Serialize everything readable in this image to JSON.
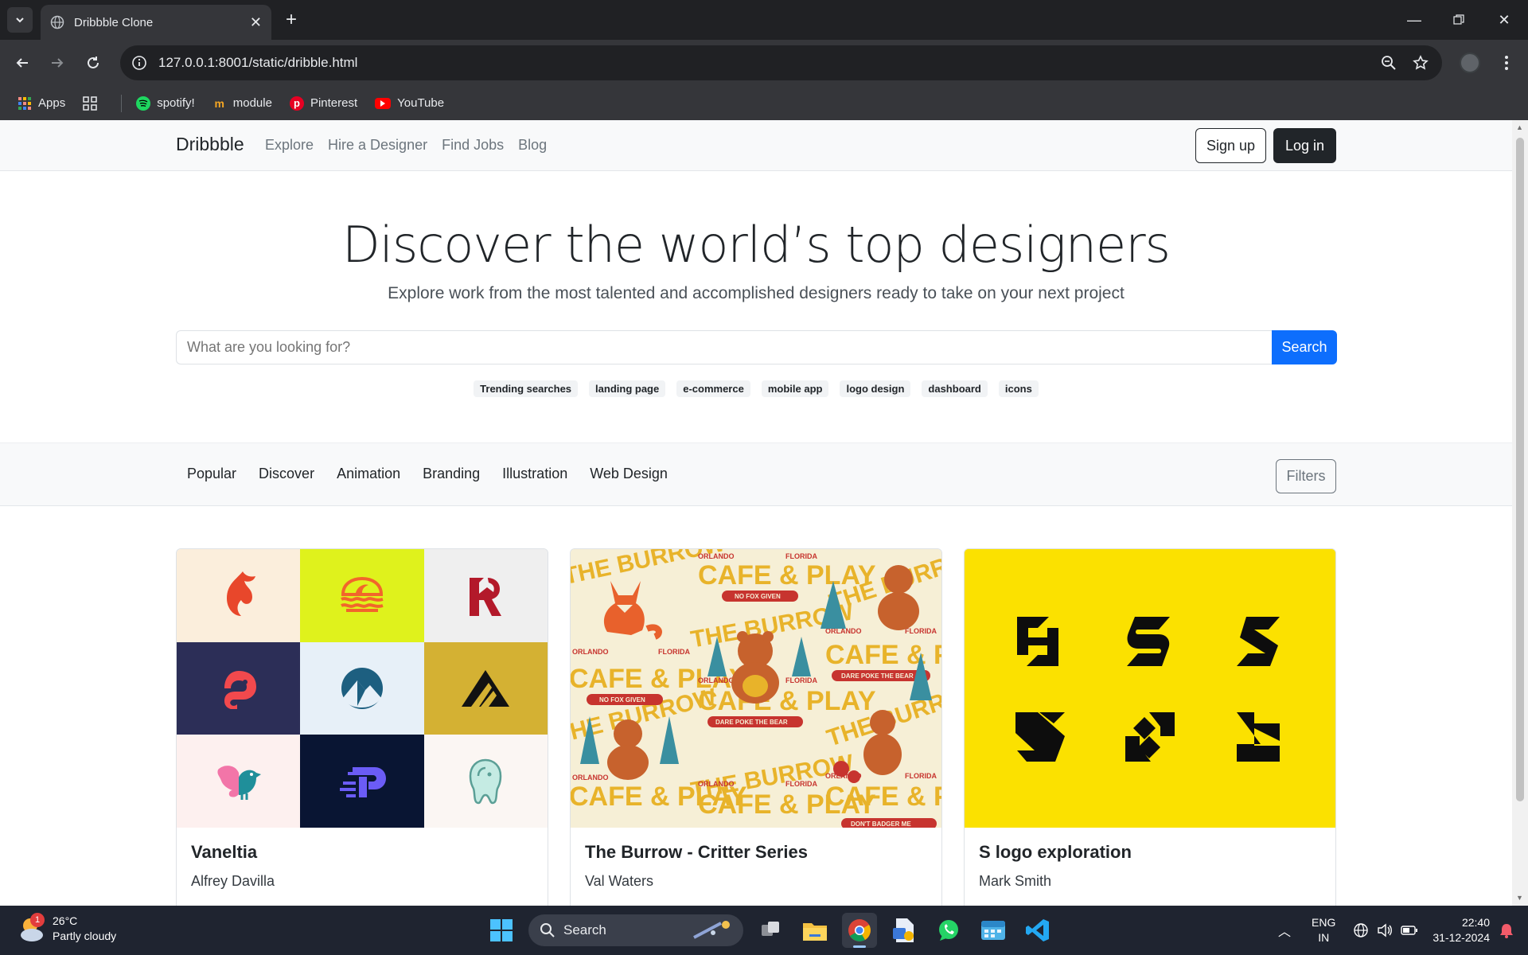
{
  "browser": {
    "tab_title": "Dribbble Clone",
    "url": "127.0.0.1:8001/static/dribble.html",
    "bookmarks": [
      {
        "label": "Apps",
        "icon": "apps-grid-icon"
      },
      {
        "label": "",
        "icon": "tab-groups-icon"
      },
      {
        "label": "spotify!",
        "icon": "spotify-icon"
      },
      {
        "label": "module",
        "icon": "module-icon"
      },
      {
        "label": "Pinterest",
        "icon": "pinterest-icon"
      },
      {
        "label": "YouTube",
        "icon": "youtube-icon"
      }
    ]
  },
  "navbar": {
    "brand": "Dribbble",
    "links": [
      "Explore",
      "Hire a Designer",
      "Find Jobs",
      "Blog"
    ],
    "signup": "Sign up",
    "login": "Log in"
  },
  "hero": {
    "title": "Discover the world’s top designers",
    "subtitle": "Explore work from the most talented and accomplished designers ready to take on your next project",
    "search_placeholder": "What are you looking for?",
    "search_button": "Search",
    "trending_label": "Trending searches",
    "trending": [
      "landing page",
      "e-commerce",
      "mobile app",
      "logo design",
      "dashboard",
      "icons"
    ]
  },
  "categories": {
    "items": [
      "Popular",
      "Discover",
      "Animation",
      "Branding",
      "Illustration",
      "Web Design"
    ],
    "filters": "Filters"
  },
  "shots": [
    {
      "title": "Vaneltia",
      "author": "Alfrey Davilla"
    },
    {
      "title": "The Burrow - Critter Series",
      "author": "Val Waters"
    },
    {
      "title": "S logo exploration",
      "author": "Mark Smith"
    }
  ],
  "burrow_art": {
    "line1": "THE BURROW",
    "line2": "ORLANDO",
    "line3": "FLORIDA",
    "line4": "CAFE & PLAY",
    "line5": "NO FOX GIVEN",
    "line6": "DARE POKE THE BEAR",
    "line7": "DON'T BADGER ME"
  },
  "taskbar": {
    "temp": "26°C",
    "weather": "Partly cloudy",
    "weather_badge": "1",
    "search": "Search",
    "lang1": "ENG",
    "lang2": "IN",
    "time": "22:40",
    "date": "31-12-2024"
  },
  "colors": {
    "accent": "#0d6efd",
    "dark": "#212529",
    "chrome_bg": "#202124"
  }
}
